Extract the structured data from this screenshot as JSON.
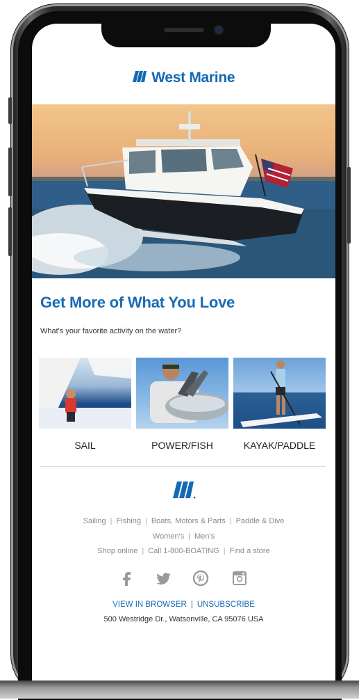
{
  "brand": {
    "name": "West Marine",
    "color": "#1569b3"
  },
  "hero": {
    "image": "boat-at-sunset-photo"
  },
  "headline": "Get More of What You Love",
  "subtext": "What's your favorite activity on the water?",
  "activities": [
    {
      "label": "SAIL",
      "image": "sailing-photo"
    },
    {
      "label": "POWER/FISH",
      "image": "fishing-photo"
    },
    {
      "label": "KAYAK/PADDLE",
      "image": "paddleboard-photo"
    }
  ],
  "footer": {
    "nav_row1": [
      "Sailing",
      "Fishing",
      "Boats, Motors & Parts",
      "Paddle & Dive"
    ],
    "nav_row2": [
      "Women's",
      "Men's"
    ],
    "nav_row3": [
      "Shop online",
      "Call 1-800-BOATING",
      "Find a store"
    ],
    "social": [
      "facebook-icon",
      "twitter-icon",
      "pinterest-icon",
      "instagram-icon"
    ],
    "view_in_browser": "VIEW IN BROWSER",
    "unsubscribe": "UNSUBSCRIBE",
    "address": "500 Westridge Dr., Watsonville, CA 95076 USA"
  }
}
